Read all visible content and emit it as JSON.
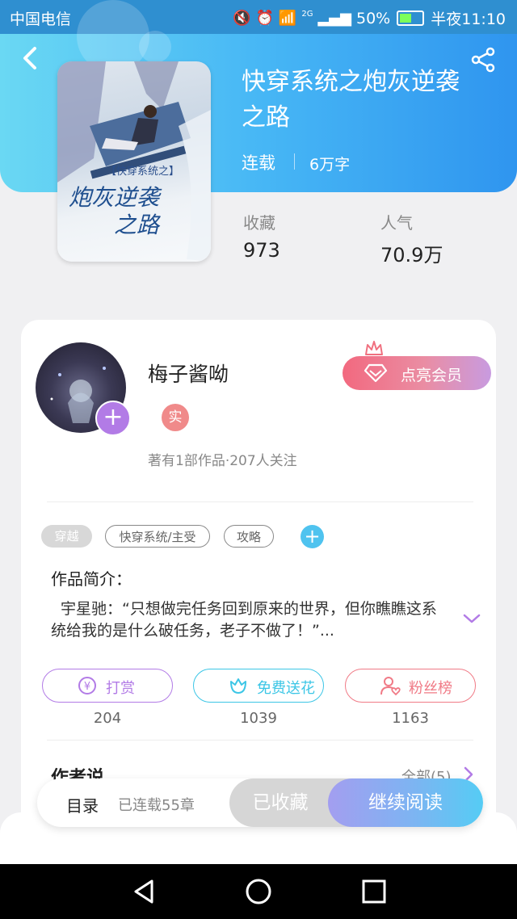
{
  "status_bar": {
    "carrier": "中国电信",
    "network": "2G",
    "battery": "50%",
    "time": "半夜11:10"
  },
  "book": {
    "title": "快穿系统之炮灰逆袭之路",
    "status": "连载",
    "word_count": "6万字",
    "cover_text_small": "【快穿系统之】",
    "cover_text_big": "炮灰逆袭之路",
    "stats": {
      "collect_label": "收藏",
      "collect_value": "973",
      "popularity_label": "人气",
      "popularity_value": "70.9万"
    }
  },
  "author": {
    "name": "梅子酱呦",
    "verified_badge": "实",
    "meta": "著有1部作品·207人关注",
    "vip_button": "点亮会员"
  },
  "tags": [
    "穿越",
    "快穿系统/主受",
    "攻略"
  ],
  "intro": {
    "label": "作品简介：",
    "text": "宇星驰：“只想做完任务回到原来的世界，但你瞧瞧这系统给我的是什么破任务，老子不做了！”..."
  },
  "actions": [
    {
      "label": "打赏",
      "count": "204",
      "icon": "yen-coin-icon",
      "color": "#b27be6"
    },
    {
      "label": "免费送花",
      "count": "1039",
      "icon": "flower-icon",
      "color": "#3cc6e6"
    },
    {
      "label": "粉丝榜",
      "count": "1163",
      "icon": "user-heart-icon",
      "color": "#f07a86"
    }
  ],
  "author_say": {
    "label": "作者说",
    "all_link": "全部(5)"
  },
  "bottom": {
    "toc": "目录",
    "chapters": "已连载55章",
    "collected": "已收藏",
    "continue": "继续阅读"
  },
  "colors": {
    "header_start": "#6ad8f3",
    "header_end": "#2f95ef",
    "accent_purple": "#b27be6"
  }
}
